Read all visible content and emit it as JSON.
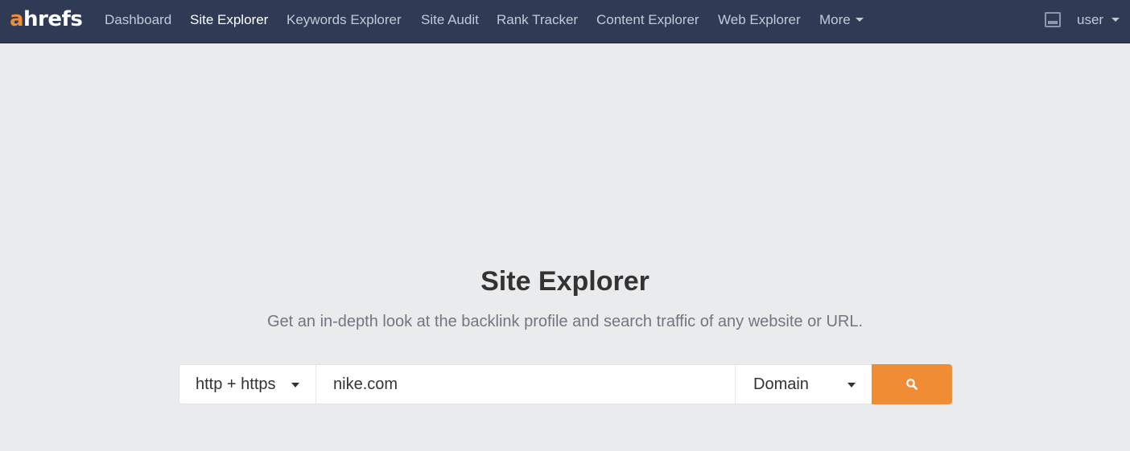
{
  "brand": {
    "logo_accent": "a",
    "logo_rest": "hrefs",
    "accent_color": "#f08c33",
    "nav_bg": "#2f3b55"
  },
  "nav": {
    "items": [
      {
        "label": "Dashboard",
        "active": false
      },
      {
        "label": "Site Explorer",
        "active": true
      },
      {
        "label": "Keywords Explorer",
        "active": false
      },
      {
        "label": "Site Audit",
        "active": false
      },
      {
        "label": "Rank Tracker",
        "active": false
      },
      {
        "label": "Content Explorer",
        "active": false
      },
      {
        "label": "Web Explorer",
        "active": false
      },
      {
        "label": "More",
        "active": false
      }
    ],
    "user_label": "user",
    "icons": {
      "inbox": "inbox-icon",
      "more": "chevron-down-icon",
      "user": "chevron-down-icon"
    }
  },
  "main": {
    "title": "Site Explorer",
    "subtitle": "Get an in-depth look at the backlink profile and search traffic of any website or URL."
  },
  "search": {
    "protocol": "http + https",
    "url_value": "nike.com",
    "mode": "Domain",
    "button_icon": "search-icon"
  }
}
